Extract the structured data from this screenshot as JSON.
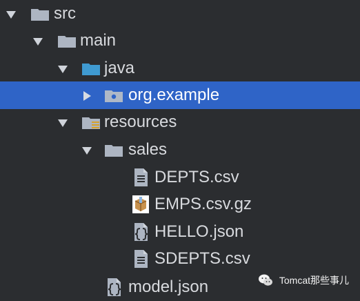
{
  "tree": [
    {
      "label": "src",
      "type": "folder",
      "expanded": true,
      "selected": false,
      "level": 0
    },
    {
      "label": "main",
      "type": "folder",
      "expanded": true,
      "selected": false,
      "level": 1
    },
    {
      "label": "java",
      "type": "source-folder",
      "expanded": true,
      "selected": false,
      "level": 2
    },
    {
      "label": "org.example",
      "type": "package",
      "expanded": false,
      "selected": true,
      "level": 3
    },
    {
      "label": "resources",
      "type": "resources-folder",
      "expanded": true,
      "selected": false,
      "level": 2
    },
    {
      "label": "sales",
      "type": "folder",
      "expanded": true,
      "selected": false,
      "level": 3
    },
    {
      "label": "DEPTS.csv",
      "type": "file-csv",
      "selected": false,
      "level": 4
    },
    {
      "label": "EMPS.csv.gz",
      "type": "file-archive",
      "selected": false,
      "level": 4
    },
    {
      "label": "HELLO.json",
      "type": "file-json",
      "selected": false,
      "level": 4
    },
    {
      "label": "SDEPTS.csv",
      "type": "file-csv",
      "selected": false,
      "level": 4
    },
    {
      "label": "model.json",
      "type": "file-json",
      "selected": false,
      "level": 3
    }
  ],
  "watermark": {
    "text": "Tomcat那些事儿",
    "icon": "wechat-icon"
  },
  "colors": {
    "background": "#2b2d30",
    "selection": "#2f64c7",
    "text": "#d8dade",
    "folder": "#adb5c2",
    "source_folder": "#3f9ad1"
  }
}
